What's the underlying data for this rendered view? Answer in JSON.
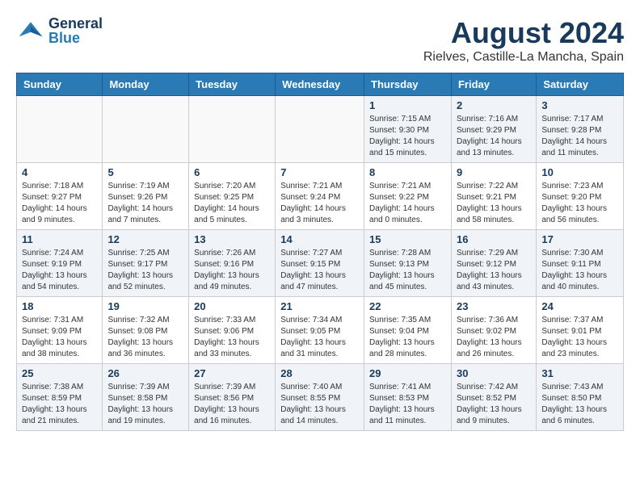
{
  "header": {
    "logo_general": "General",
    "logo_blue": "Blue",
    "title": "August 2024",
    "subtitle": "Rielves, Castille-La Mancha, Spain"
  },
  "weekdays": [
    "Sunday",
    "Monday",
    "Tuesday",
    "Wednesday",
    "Thursday",
    "Friday",
    "Saturday"
  ],
  "weeks": [
    [
      {
        "day": "",
        "sunrise": "",
        "sunset": "",
        "daylight": ""
      },
      {
        "day": "",
        "sunrise": "",
        "sunset": "",
        "daylight": ""
      },
      {
        "day": "",
        "sunrise": "",
        "sunset": "",
        "daylight": ""
      },
      {
        "day": "",
        "sunrise": "",
        "sunset": "",
        "daylight": ""
      },
      {
        "day": "1",
        "sunrise": "Sunrise: 7:15 AM",
        "sunset": "Sunset: 9:30 PM",
        "daylight": "Daylight: 14 hours and 15 minutes."
      },
      {
        "day": "2",
        "sunrise": "Sunrise: 7:16 AM",
        "sunset": "Sunset: 9:29 PM",
        "daylight": "Daylight: 14 hours and 13 minutes."
      },
      {
        "day": "3",
        "sunrise": "Sunrise: 7:17 AM",
        "sunset": "Sunset: 9:28 PM",
        "daylight": "Daylight: 14 hours and 11 minutes."
      }
    ],
    [
      {
        "day": "4",
        "sunrise": "Sunrise: 7:18 AM",
        "sunset": "Sunset: 9:27 PM",
        "daylight": "Daylight: 14 hours and 9 minutes."
      },
      {
        "day": "5",
        "sunrise": "Sunrise: 7:19 AM",
        "sunset": "Sunset: 9:26 PM",
        "daylight": "Daylight: 14 hours and 7 minutes."
      },
      {
        "day": "6",
        "sunrise": "Sunrise: 7:20 AM",
        "sunset": "Sunset: 9:25 PM",
        "daylight": "Daylight: 14 hours and 5 minutes."
      },
      {
        "day": "7",
        "sunrise": "Sunrise: 7:21 AM",
        "sunset": "Sunset: 9:24 PM",
        "daylight": "Daylight: 14 hours and 3 minutes."
      },
      {
        "day": "8",
        "sunrise": "Sunrise: 7:21 AM",
        "sunset": "Sunset: 9:22 PM",
        "daylight": "Daylight: 14 hours and 0 minutes."
      },
      {
        "day": "9",
        "sunrise": "Sunrise: 7:22 AM",
        "sunset": "Sunset: 9:21 PM",
        "daylight": "Daylight: 13 hours and 58 minutes."
      },
      {
        "day": "10",
        "sunrise": "Sunrise: 7:23 AM",
        "sunset": "Sunset: 9:20 PM",
        "daylight": "Daylight: 13 hours and 56 minutes."
      }
    ],
    [
      {
        "day": "11",
        "sunrise": "Sunrise: 7:24 AM",
        "sunset": "Sunset: 9:19 PM",
        "daylight": "Daylight: 13 hours and 54 minutes."
      },
      {
        "day": "12",
        "sunrise": "Sunrise: 7:25 AM",
        "sunset": "Sunset: 9:17 PM",
        "daylight": "Daylight: 13 hours and 52 minutes."
      },
      {
        "day": "13",
        "sunrise": "Sunrise: 7:26 AM",
        "sunset": "Sunset: 9:16 PM",
        "daylight": "Daylight: 13 hours and 49 minutes."
      },
      {
        "day": "14",
        "sunrise": "Sunrise: 7:27 AM",
        "sunset": "Sunset: 9:15 PM",
        "daylight": "Daylight: 13 hours and 47 minutes."
      },
      {
        "day": "15",
        "sunrise": "Sunrise: 7:28 AM",
        "sunset": "Sunset: 9:13 PM",
        "daylight": "Daylight: 13 hours and 45 minutes."
      },
      {
        "day": "16",
        "sunrise": "Sunrise: 7:29 AM",
        "sunset": "Sunset: 9:12 PM",
        "daylight": "Daylight: 13 hours and 43 minutes."
      },
      {
        "day": "17",
        "sunrise": "Sunrise: 7:30 AM",
        "sunset": "Sunset: 9:11 PM",
        "daylight": "Daylight: 13 hours and 40 minutes."
      }
    ],
    [
      {
        "day": "18",
        "sunrise": "Sunrise: 7:31 AM",
        "sunset": "Sunset: 9:09 PM",
        "daylight": "Daylight: 13 hours and 38 minutes."
      },
      {
        "day": "19",
        "sunrise": "Sunrise: 7:32 AM",
        "sunset": "Sunset: 9:08 PM",
        "daylight": "Daylight: 13 hours and 36 minutes."
      },
      {
        "day": "20",
        "sunrise": "Sunrise: 7:33 AM",
        "sunset": "Sunset: 9:06 PM",
        "daylight": "Daylight: 13 hours and 33 minutes."
      },
      {
        "day": "21",
        "sunrise": "Sunrise: 7:34 AM",
        "sunset": "Sunset: 9:05 PM",
        "daylight": "Daylight: 13 hours and 31 minutes."
      },
      {
        "day": "22",
        "sunrise": "Sunrise: 7:35 AM",
        "sunset": "Sunset: 9:04 PM",
        "daylight": "Daylight: 13 hours and 28 minutes."
      },
      {
        "day": "23",
        "sunrise": "Sunrise: 7:36 AM",
        "sunset": "Sunset: 9:02 PM",
        "daylight": "Daylight: 13 hours and 26 minutes."
      },
      {
        "day": "24",
        "sunrise": "Sunrise: 7:37 AM",
        "sunset": "Sunset: 9:01 PM",
        "daylight": "Daylight: 13 hours and 23 minutes."
      }
    ],
    [
      {
        "day": "25",
        "sunrise": "Sunrise: 7:38 AM",
        "sunset": "Sunset: 8:59 PM",
        "daylight": "Daylight: 13 hours and 21 minutes."
      },
      {
        "day": "26",
        "sunrise": "Sunrise: 7:39 AM",
        "sunset": "Sunset: 8:58 PM",
        "daylight": "Daylight: 13 hours and 19 minutes."
      },
      {
        "day": "27",
        "sunrise": "Sunrise: 7:39 AM",
        "sunset": "Sunset: 8:56 PM",
        "daylight": "Daylight: 13 hours and 16 minutes."
      },
      {
        "day": "28",
        "sunrise": "Sunrise: 7:40 AM",
        "sunset": "Sunset: 8:55 PM",
        "daylight": "Daylight: 13 hours and 14 minutes."
      },
      {
        "day": "29",
        "sunrise": "Sunrise: 7:41 AM",
        "sunset": "Sunset: 8:53 PM",
        "daylight": "Daylight: 13 hours and 11 minutes."
      },
      {
        "day": "30",
        "sunrise": "Sunrise: 7:42 AM",
        "sunset": "Sunset: 8:52 PM",
        "daylight": "Daylight: 13 hours and 9 minutes."
      },
      {
        "day": "31",
        "sunrise": "Sunrise: 7:43 AM",
        "sunset": "Sunset: 8:50 PM",
        "daylight": "Daylight: 13 hours and 6 minutes."
      }
    ]
  ]
}
